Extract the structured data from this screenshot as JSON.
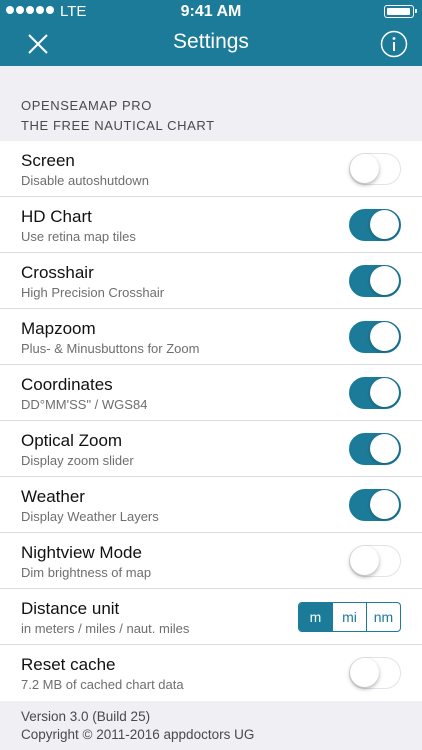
{
  "status_bar": {
    "carrier": "LTE",
    "time": "9:41 AM",
    "battery_level": 0.9
  },
  "header": {
    "title": "Settings",
    "close_icon": "close-icon",
    "info_icon": "info-icon",
    "background_color": "#1b7b99"
  },
  "section": {
    "line1": "OPENSEAMAP PRO",
    "line2": "THE FREE NAUTICAL CHART"
  },
  "rows": [
    {
      "title": "Screen",
      "subtitle": "Disable autoshutdown",
      "on": false
    },
    {
      "title": "HD Chart",
      "subtitle": "Use retina map tiles",
      "on": true
    },
    {
      "title": "Crosshair",
      "subtitle": "High Precision Crosshair",
      "on": true
    },
    {
      "title": "Mapzoom",
      "subtitle": "Plus- & Minusbuttons for Zoom",
      "on": true
    },
    {
      "title": "Coordinates",
      "subtitle": "DD°MM'SS\" / WGS84",
      "on": true
    },
    {
      "title": "Optical Zoom",
      "subtitle": "Display zoom slider",
      "on": true
    },
    {
      "title": "Weather",
      "subtitle": "Display Weather Layers",
      "on": true
    },
    {
      "title": "Nightview Mode",
      "subtitle": "Dim brightness of map",
      "on": false
    }
  ],
  "distance": {
    "title": "Distance unit",
    "subtitle": "in meters / miles / naut. miles",
    "options": [
      "m",
      "mi",
      "nm"
    ],
    "selected": "m"
  },
  "reset_cache": {
    "title": "Reset cache",
    "subtitle": "7.2 MB of cached chart data",
    "on": false
  },
  "footer": {
    "version": "Version 3.0 (Build 25)",
    "copyright": "Copyright © 2011-2016 appdoctors UG"
  },
  "accent_color": "#1b7b99"
}
